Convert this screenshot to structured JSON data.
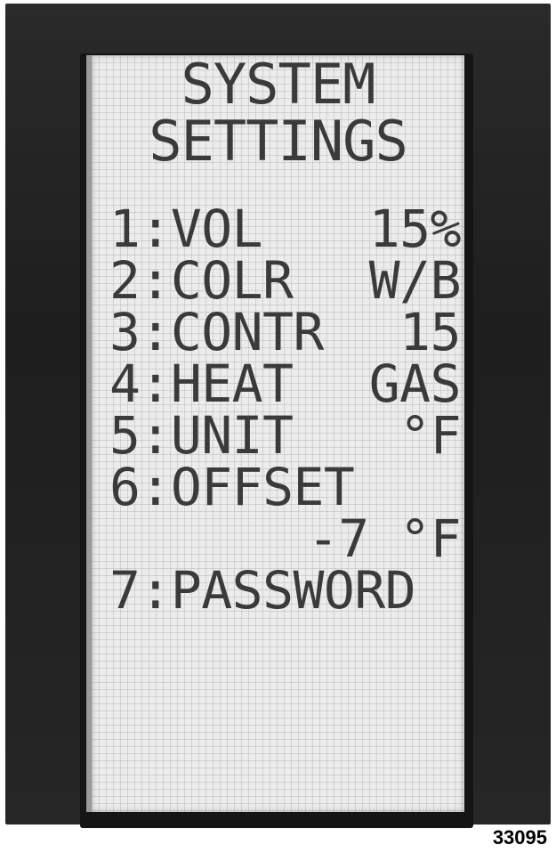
{
  "screen": {
    "title_line_1": "SYSTEM",
    "title_line_2": "SETTINGS",
    "items": [
      {
        "label": "1:VOL",
        "value": "15%"
      },
      {
        "label": "2:COLR",
        "value": "W/B"
      },
      {
        "label": "3:CONTR",
        "value": "15"
      },
      {
        "label": "4:HEAT",
        "value": "GAS"
      },
      {
        "label": "5:UNIT",
        "value": "°F"
      },
      {
        "label": "6:OFFSET",
        "value": "-7 °F"
      },
      {
        "label": "7:PASSWORD",
        "value": ""
      }
    ]
  },
  "figure_number": "33095"
}
